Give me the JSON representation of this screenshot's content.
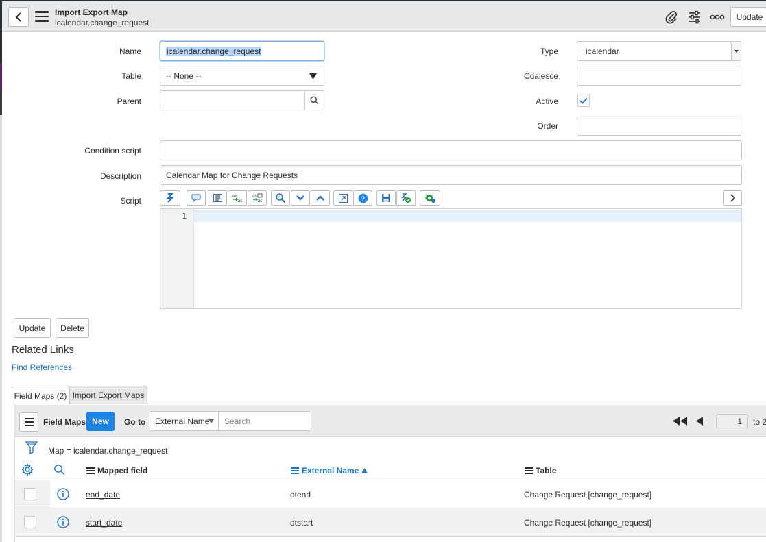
{
  "header": {
    "title": "Import Export Map",
    "subtitle": "icalendar.change_request",
    "update_label": "Update"
  },
  "form": {
    "name_label": "Name",
    "name_value": "icalendar.change_request",
    "table_label": "Table",
    "table_value": "-- None --",
    "parent_label": "Parent",
    "parent_value": "",
    "type_label": "Type",
    "type_value": "icalendar",
    "coalesce_label": "Coalesce",
    "coalesce_value": "",
    "active_label": "Active",
    "active_checked": true,
    "order_label": "Order",
    "order_value": "",
    "condition_label": "Condition script",
    "condition_value": "",
    "description_label": "Description",
    "description_value": "Calendar Map for Change Requests",
    "script_label": "Script",
    "script_line_number": "1"
  },
  "actions": {
    "update_label": "Update",
    "delete_label": "Delete"
  },
  "related": {
    "heading": "Related Links",
    "find_references": "Find References"
  },
  "tabs": [
    {
      "label": "Field Maps (2)",
      "active": true
    },
    {
      "label": "Import Export Maps",
      "active": false
    }
  ],
  "list": {
    "title": "Field Maps",
    "new_label": "New",
    "goto_label": "Go to",
    "goto_field": "External Name",
    "search_placeholder": "Search",
    "page_value": "1",
    "page_to": "to 2",
    "filter": "Map = icalendar.change_request",
    "columns": [
      "Mapped field",
      "External Name",
      "Table"
    ],
    "rows": [
      {
        "mapped_field": "end_date",
        "external_name": "dtend",
        "table": "Change Request [change_request]"
      },
      {
        "mapped_field": "start_date",
        "external_name": "dtstart",
        "table": "Change Request [change_request]"
      }
    ]
  },
  "colors": {
    "accent": "#1d83e6",
    "link": "#1f73c4",
    "header_bg": "#e6e8ea"
  }
}
